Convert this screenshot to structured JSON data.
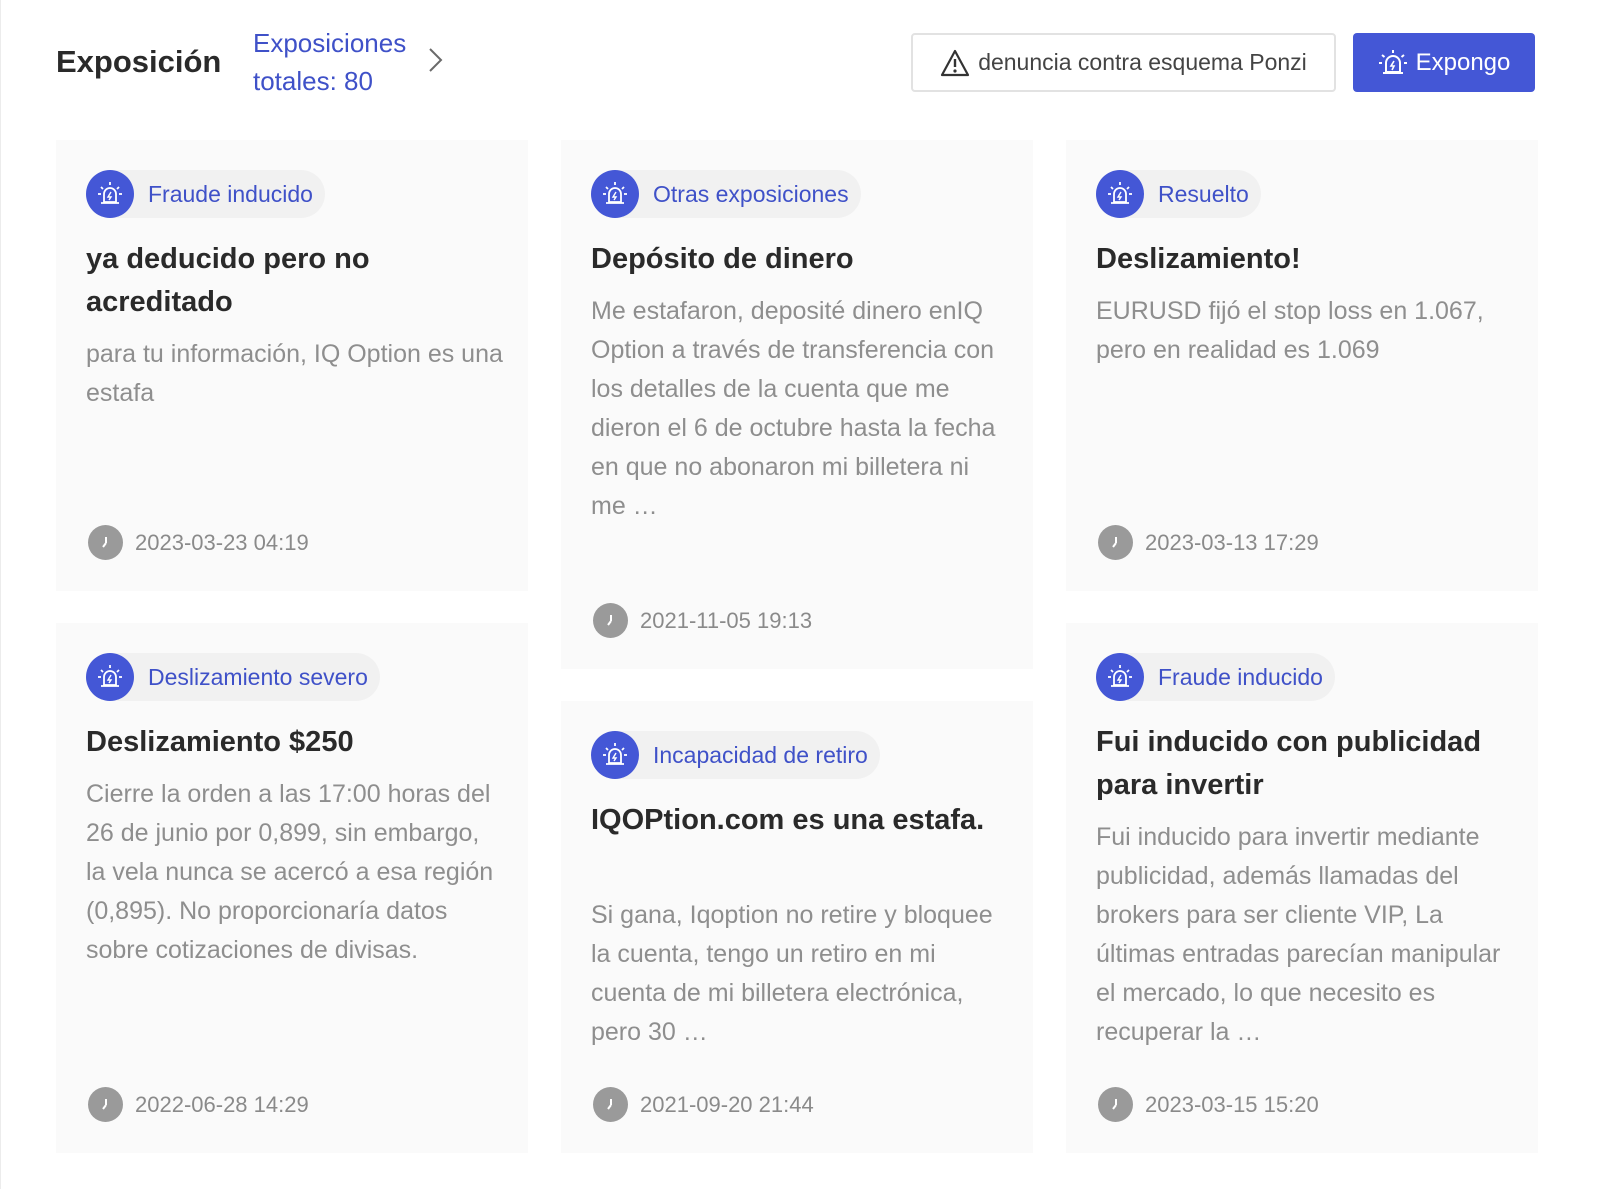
{
  "header": {
    "title": "Exposición",
    "total_label": "Exposiciones totales: 80",
    "ponzi_button_label": "denuncia contra esquema Ponzi",
    "expose_button_label": "Expongo"
  },
  "colors": {
    "accent": "#4457d6",
    "link": "#3f51c8",
    "card_bg": "#fafafa",
    "muted_text": "#8e8e8e"
  },
  "cards": [
    {
      "tag": "Fraude inducido",
      "title": "ya deducido pero no acreditado",
      "description": "para tu información, IQ Option es una estafa",
      "time": "2023-03-23 04:19"
    },
    {
      "tag": "Otras exposiciones",
      "title": "Depósito de dinero",
      "description": "Me estafaron, deposité dinero enIQ Option a través de transferencia con los detalles de la cuenta que me dieron el 6 de octubre hasta la fecha en que no abonaron mi billetera ni me …",
      "time": "2021-11-05 19:13"
    },
    {
      "tag": "Resuelto",
      "title": "Deslizamiento!",
      "description": "EURUSD fijó el stop loss en 1.067, pero en realidad es 1.069",
      "time": "2023-03-13 17:29"
    },
    {
      "tag": "Deslizamiento severo",
      "title": "Deslizamiento $250",
      "description": "Cierre la orden a las 17:00 horas del 26 de junio por 0,899, sin embargo, la vela nunca se acercó a esa región (0,895). No proporcionaría datos sobre cotizaciones de divisas.",
      "time": "2022-06-28 14:29"
    },
    {
      "tag": "Incapacidad de retiro",
      "title": "IQOPtion.com es una estafa.",
      "description": "Si gana, Iqoption no retire y bloquee la cuenta, tengo un retiro en mi cuenta de mi billetera electrónica, pero 30 …",
      "time": "2021-09-20 21:44"
    },
    {
      "tag": "Fraude inducido",
      "title": "Fui inducido con publicidad para invertir",
      "description": "Fui inducido para invertir mediante publicidad, además llamadas del brokers para ser cliente VIP, La últimas entradas parecían manipular el mercado, lo que necesito es recuperar la …",
      "time": "2023-03-15 15:20"
    }
  ]
}
